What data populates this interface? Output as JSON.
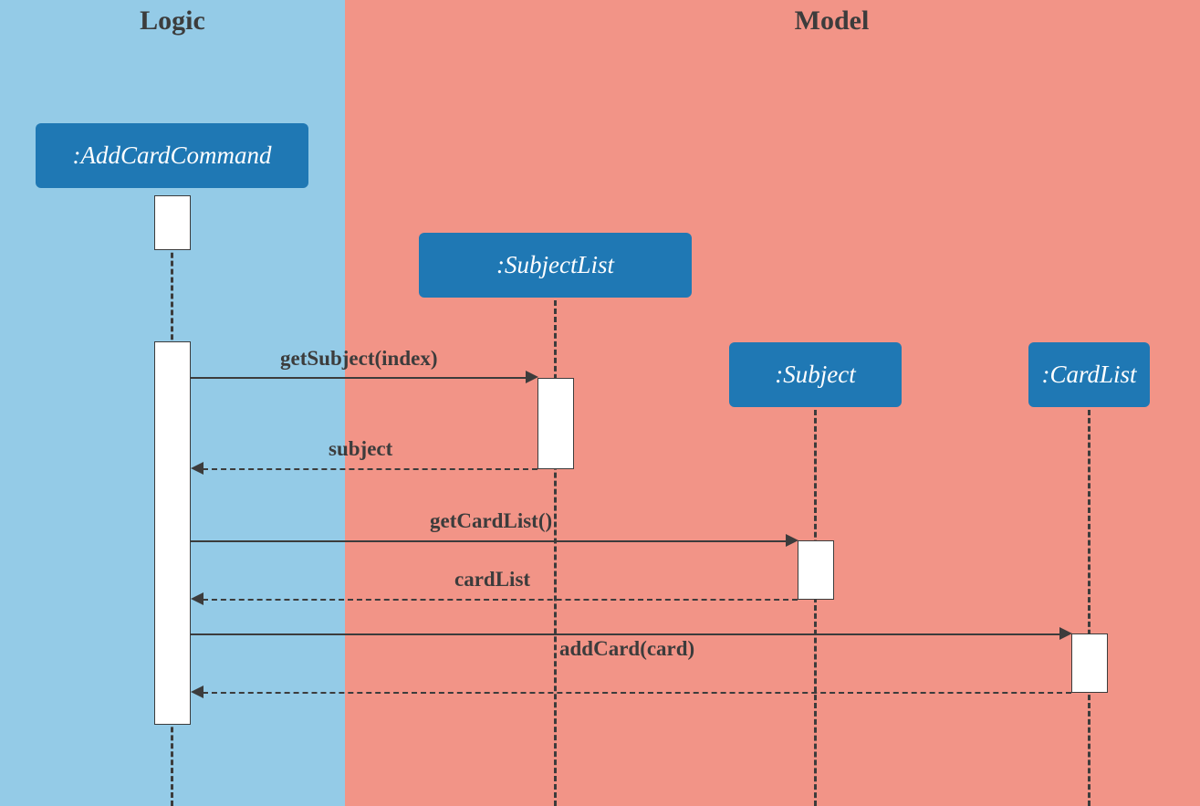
{
  "regions": {
    "logic": "Logic",
    "model": "Model"
  },
  "participants": {
    "addCardCommand": ":AddCardCommand",
    "subjectList": ":SubjectList",
    "subject": ":Subject",
    "cardList": ":CardList"
  },
  "messages": {
    "getSubject": "getSubject(index)",
    "subjectReturn": "subject",
    "getCardList": "getCardList()",
    "cardListReturn": "cardList",
    "addCard": "addCard(card)"
  },
  "chart_data": {
    "type": "sequence-diagram",
    "regions": [
      {
        "name": "Logic",
        "participants": [
          "AddCardCommand"
        ]
      },
      {
        "name": "Model",
        "participants": [
          "SubjectList",
          "Subject",
          "CardList"
        ]
      }
    ],
    "participants": [
      "AddCardCommand",
      "SubjectList",
      "Subject",
      "CardList"
    ],
    "interactions": [
      {
        "from": "AddCardCommand",
        "to": "SubjectList",
        "message": "getSubject(index)",
        "type": "call"
      },
      {
        "from": "SubjectList",
        "to": "AddCardCommand",
        "message": "subject",
        "type": "return"
      },
      {
        "from": "AddCardCommand",
        "to": "Subject",
        "message": "getCardList()",
        "type": "call"
      },
      {
        "from": "Subject",
        "to": "AddCardCommand",
        "message": "cardList",
        "type": "return"
      },
      {
        "from": "AddCardCommand",
        "to": "CardList",
        "message": "addCard(card)",
        "type": "call"
      },
      {
        "from": "CardList",
        "to": "AddCardCommand",
        "message": "",
        "type": "return"
      }
    ]
  }
}
